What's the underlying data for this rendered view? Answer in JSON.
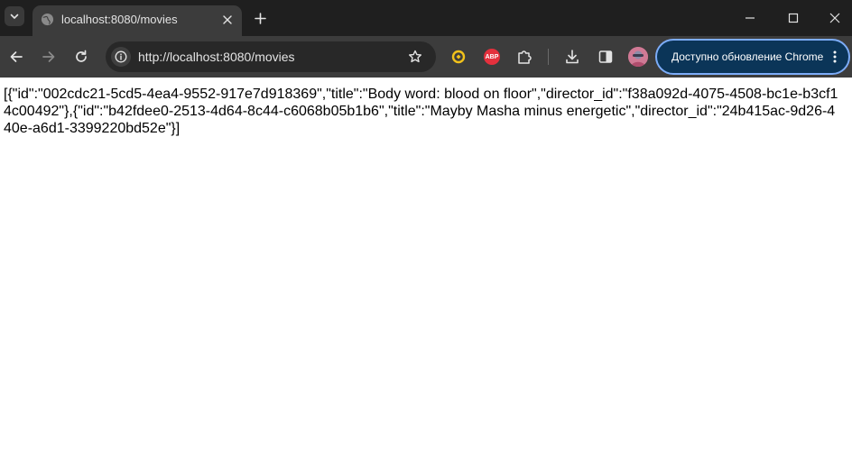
{
  "browser": {
    "tab": {
      "title": "localhost:8080/movies",
      "favicon": "globe-icon"
    },
    "window_controls": [
      "minimize-icon",
      "maximize-icon",
      "close-icon"
    ],
    "toolbar": {
      "url": "http://localhost:8080/movies",
      "update_button_label": "Доступно обновление Chrome",
      "extensions": [
        "extension-ring-icon",
        "adblock-plus-icon",
        "puzzle-icon"
      ],
      "abp_label": "ABP"
    },
    "colors": {
      "tabstrip": "#1f1f1f",
      "toolbar": "#3c3c3c",
      "update_accent": "#7cacf8"
    }
  },
  "page": {
    "body_text": "[{\"id\":\"002cdc21-5cd5-4ea4-9552-917e7d918369\",\"title\":\"Body word: blood on floor\",\"director_id\":\"f38a092d-4075-4508-bc1e-b3cf14c00492\"},{\"id\":\"b42fdee0-2513-4d64-8c44-c6068b05b1b6\",\"title\":\"Mayby Masha minus energetic\",\"director_id\":\"24b415ac-9d26-440e-a6d1-3399220bd52e\"}]"
  }
}
